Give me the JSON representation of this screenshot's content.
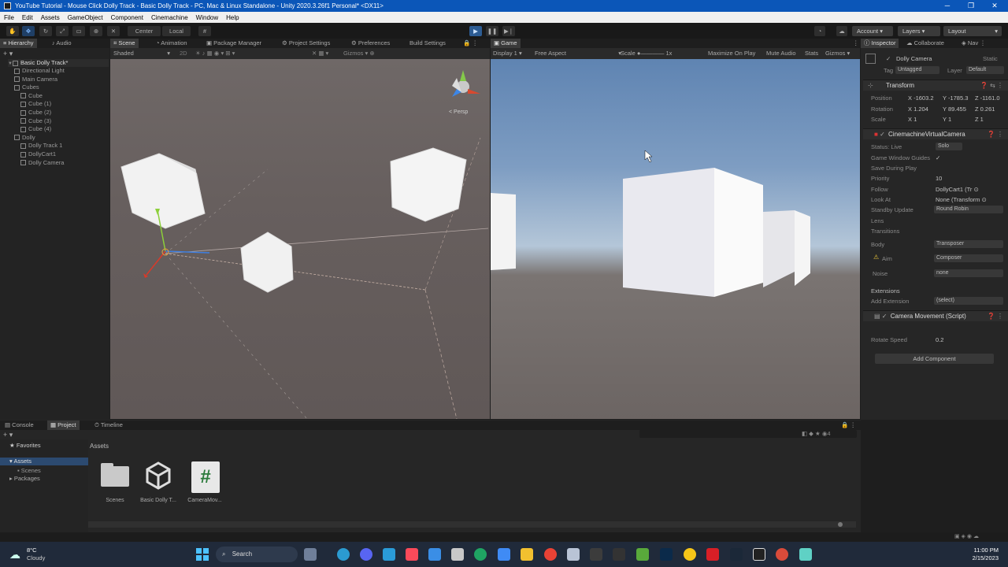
{
  "window": {
    "title": "YouTube Tutorial - Mouse Click Dolly Track - Basic Dolly Track - PC, Mac & Linux Standalone - Unity 2020.3.26f1 Personal* <DX11>",
    "minimize": "─",
    "maximize": "❐",
    "close": "✕"
  },
  "menu": [
    "File",
    "Edit",
    "Assets",
    "GameObject",
    "Component",
    "Cinemachine",
    "Window",
    "Help"
  ],
  "toolbar": {
    "pivot": "Center",
    "space": "Local",
    "account": "Account",
    "layers": "Layers",
    "layout": "Layout"
  },
  "hierarchy": {
    "tab": "Hierarchy",
    "audio_tab": "Audio",
    "scene_name": "Basic Dolly Track*",
    "items": [
      {
        "label": "Directional Light",
        "indent": 1
      },
      {
        "label": "Main Camera",
        "indent": 1
      },
      {
        "label": "Cubes",
        "indent": 1
      },
      {
        "label": "Cube",
        "indent": 2
      },
      {
        "label": "Cube (1)",
        "indent": 2
      },
      {
        "label": "Cube (2)",
        "indent": 2
      },
      {
        "label": "Cube (3)",
        "indent": 2
      },
      {
        "label": "Cube (4)",
        "indent": 2
      },
      {
        "label": "Dolly",
        "indent": 1
      },
      {
        "label": "Dolly Track 1",
        "indent": 2
      },
      {
        "label": "DollyCart1",
        "indent": 2
      },
      {
        "label": "Dolly Camera",
        "indent": 2
      }
    ]
  },
  "center_tabs": [
    "Scene",
    "Animation",
    "Package Manager",
    "Project Settings",
    "Preferences",
    "Build Settings"
  ],
  "scene": {
    "shading": "Shaded",
    "mode": "2D",
    "gizmos": "Gizmos",
    "persp": "< Persp"
  },
  "game": {
    "tab": "Game",
    "display": "Display 1",
    "aspect": "Free Aspect",
    "scale_label": "Scale",
    "scale_value": "1x",
    "maximize": "Maximize On Play",
    "mute": "Mute Audio",
    "stats": "Stats",
    "gizmos": "Gizmos"
  },
  "inspector": {
    "tab": "Inspector",
    "tab2": "Collaborate",
    "tab3": "Nav",
    "object_name": "Dolly Camera",
    "static": "Static",
    "tag_label": "Tag",
    "tag": "Untagged",
    "layer_label": "Layer",
    "layer": "Default",
    "transform": {
      "title": "Transform",
      "position_label": "Position",
      "position": [
        "X -1603.2",
        "Y -1785.3",
        "Z -1161.0"
      ],
      "rotation_label": "Rotation",
      "rotation": [
        "X 1.204",
        "Y 89.455",
        "Z 0.261"
      ],
      "scale_label": "Scale",
      "scale": [
        "X 1",
        "Y 1",
        "Z 1"
      ]
    },
    "vcam": {
      "title": "CinemachineVirtualCamera",
      "status_label": "Status: Live",
      "solo": "Solo",
      "game_window_guides": "Game Window Guides",
      "gwg_check": "✓",
      "save_during_play": "Save During Play",
      "priority_label": "Priority",
      "priority": "10",
      "follow_label": "Follow",
      "follow": "DollyCart1 (Tr",
      "look_at_label": "Look At",
      "look_at": "None (Transform",
      "standby_label": "Standby Update",
      "standby": "Round Robin",
      "lens_label": "Lens",
      "transitions_label": "Transitions",
      "body_label": "Body",
      "body": "Transposer",
      "aim_label": "Aim",
      "aim": "Composer",
      "noise_label": "Noise",
      "noise": "none",
      "extensions_label": "Extensions",
      "add_ext_label": "Add Extension",
      "add_ext": "(select)"
    },
    "script": {
      "title": "Camera Movement (Script)",
      "rotate_label": "Rotate Speed",
      "rotate": "0.2"
    },
    "add_component": "Add Component"
  },
  "bottom": {
    "tabs": [
      "Console",
      "Project",
      "Timeline"
    ],
    "favorites": "Favorites",
    "tree": [
      "Assets",
      "Scenes",
      "Packages"
    ],
    "breadcrumb": "Assets",
    "assets": [
      {
        "name": "Scenes",
        "icon": "folder-icon"
      },
      {
        "name": "Basic Dolly T...",
        "icon": "unity-icon"
      },
      {
        "name": "CameraMov...",
        "icon": "csharp-script-icon"
      }
    ],
    "hash": "#"
  },
  "taskbar": {
    "temp": "8°C",
    "weather": "Cloudy",
    "search": "Search",
    "time": "11:00 PM",
    "date": "2/15/2023"
  }
}
